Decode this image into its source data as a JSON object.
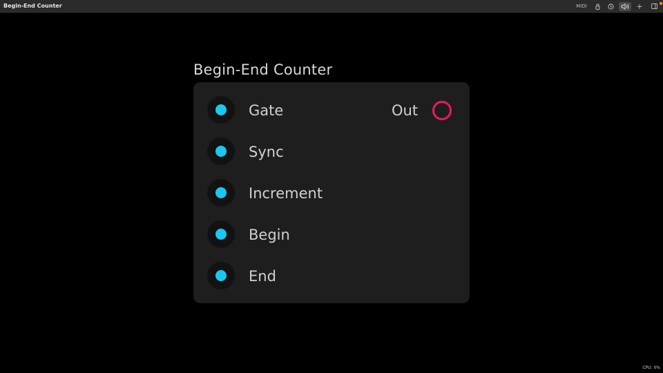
{
  "window": {
    "title": "Begin-End Counter"
  },
  "toolbar": {
    "midi_label": "MIDI",
    "lock_icon": "lock-icon",
    "clock_icon": "clock-icon",
    "audio_icon": "speaker-icon",
    "plus_label": "+",
    "panel_icon": "sidebar-panel-icon"
  },
  "module": {
    "title": "Begin-End Counter",
    "inputs": [
      {
        "label": "Gate"
      },
      {
        "label": "Sync"
      },
      {
        "label": "Increment"
      },
      {
        "label": "Begin"
      },
      {
        "label": "End"
      }
    ],
    "output": {
      "label": "Out"
    }
  },
  "status": {
    "cpu": "CPU: 0%"
  },
  "colors": {
    "background": "#000000",
    "module_bg": "#1e1e1f",
    "input_port": "#19c8f0",
    "output_port": "#ee1960",
    "notification": "#f0a000"
  }
}
